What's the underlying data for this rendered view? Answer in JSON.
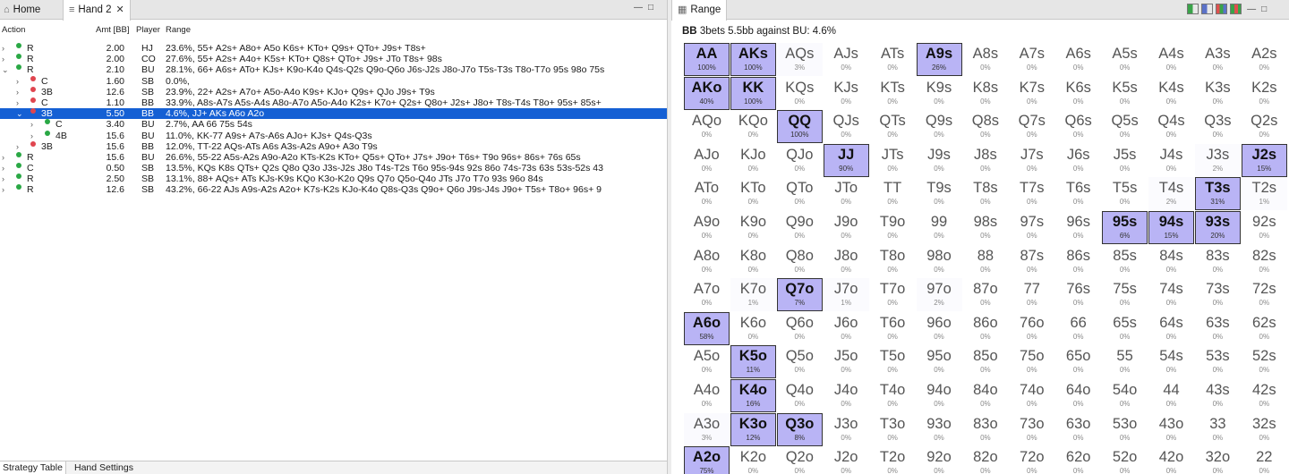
{
  "left_panel": {
    "tabs": [
      {
        "label": "Home",
        "icon": "home-icon"
      },
      {
        "label": "Hand 2",
        "icon": "tree-icon"
      }
    ],
    "columns": {
      "action": "Action",
      "amt": "Amt [BB]",
      "player": "Player",
      "range": "Range"
    },
    "rows": [
      {
        "level": 0,
        "expanded": false,
        "dot": "#2aa845",
        "action": "R",
        "amt": "2.00",
        "player": "HJ",
        "range": "23.6%, 55+ A2s+ A8o+ A5o K6s+ KTo+ Q9s+ QTo+ J9s+ T8s+",
        "selected": false
      },
      {
        "level": 0,
        "expanded": false,
        "dot": "#2aa845",
        "action": "R",
        "amt": "2.00",
        "player": "CO",
        "range": "27.6%, 55+ A2s+ A4o+ K5s+ KTo+ Q8s+ QTo+ J9s+ JTo T8s+ 98s",
        "selected": false
      },
      {
        "level": 0,
        "expanded": true,
        "dot": "#2aa845",
        "action": "R",
        "amt": "2.10",
        "player": "BU",
        "range": "28.1%, 66+ A6s+ ATo+ KJs+ K9o-K4o Q4s-Q2s Q9o-Q6o J6s-J2s J8o-J7o T5s-T3s T8o-T7o 95s 98o 75s",
        "selected": false
      },
      {
        "level": 1,
        "expanded": false,
        "dot": "#e0454f",
        "action": "C",
        "amt": "1.60",
        "player": "SB",
        "range": "0.0%,",
        "selected": false
      },
      {
        "level": 1,
        "expanded": false,
        "dot": "#e0454f",
        "action": "3B",
        "amt": "12.6",
        "player": "SB",
        "range": "23.9%, 22+ A2s+ A7o+ A5o-A4o K9s+ KJo+ Q9s+ QJo J9s+ T9s",
        "selected": false
      },
      {
        "level": 1,
        "expanded": false,
        "dot": "#e0454f",
        "action": "C",
        "amt": "1.10",
        "player": "BB",
        "range": "33.9%, A8s-A7s A5s-A4s A8o-A7o A5o-A4o K2s+ K7o+ Q2s+ Q8o+ J2s+ J8o+ T8s-T4s T8o+ 95s+ 85s+",
        "selected": false
      },
      {
        "level": 1,
        "expanded": true,
        "dot": "#e0454f",
        "action": "3B",
        "amt": "5.50",
        "player": "BB",
        "range": "4.6%, JJ+ AKs A6o A2o",
        "selected": true
      },
      {
        "level": 2,
        "expanded": false,
        "dot": "#2aa845",
        "action": "C",
        "amt": "3.40",
        "player": "BU",
        "range": "2.7%, AA 66 75s 54s",
        "selected": false
      },
      {
        "level": 2,
        "expanded": false,
        "dot": "#2aa845",
        "action": "4B",
        "amt": "15.6",
        "player": "BU",
        "range": "11.0%, KK-77 A9s+ A7s-A6s AJo+ KJs+ Q4s-Q3s",
        "selected": false
      },
      {
        "level": 1,
        "expanded": false,
        "dot": "#e0454f",
        "action": "3B",
        "amt": "15.6",
        "player": "BB",
        "range": "12.0%, TT-22 AQs-ATs A6s A3s-A2s A9o+ A3o T9s",
        "selected": false
      },
      {
        "level": 0,
        "expanded": false,
        "dot": "#2aa845",
        "action": "R",
        "amt": "15.6",
        "player": "BU",
        "range": "26.6%, 55-22 A5s-A2s A9o-A2o KTs-K2s KTo+ Q5s+ QTo+ J7s+ J9o+ T6s+ T9o 96s+ 86s+ 76s 65s",
        "selected": false
      },
      {
        "level": 0,
        "expanded": false,
        "dot": "#2aa845",
        "action": "C",
        "amt": "0.50",
        "player": "SB",
        "range": "13.5%, KQs K8s QTs+ Q2s Q8o Q3o J3s-J2s J8o T4s-T2s T6o 95s-94s 92s 86o 74s-73s 63s 53s-52s 43",
        "selected": false
      },
      {
        "level": 0,
        "expanded": false,
        "dot": "#2aa845",
        "action": "R",
        "amt": "2.50",
        "player": "SB",
        "range": "13.1%, 88+ AQs+ ATs KJs-K9s KQo K3o-K2o Q9s Q7o Q5o-Q4o JTs J7o T7o 93s 96o 84s",
        "selected": false
      },
      {
        "level": 0,
        "expanded": false,
        "dot": "#2aa845",
        "action": "R",
        "amt": "12.6",
        "player": "SB",
        "range": "43.2%, 66-22 AJs A9s-A2s A2o+ K7s-K2s KJo-K4o Q8s-Q3s Q9o+ Q6o J9s-J4s J9o+ T5s+ T8o+ 96s+ 9",
        "selected": false
      }
    ],
    "bottom_tabs": [
      "Strategy Table",
      "Hand Settings"
    ]
  },
  "right_panel": {
    "tab": {
      "label": "Range",
      "icon": "range-icon"
    },
    "title_player": "BB",
    "title_text": "3bets 5.5bb against BU: 4.6%",
    "highlight_color": "#b9b4f5",
    "grid": [
      [
        [
          "AA",
          "100%"
        ],
        [
          "AKs",
          "100%"
        ],
        [
          "AQs",
          "3%"
        ],
        [
          "AJs",
          "0%"
        ],
        [
          "ATs",
          "0%"
        ],
        [
          "A9s",
          "26%"
        ],
        [
          "A8s",
          "0%"
        ],
        [
          "A7s",
          "0%"
        ],
        [
          "A6s",
          "0%"
        ],
        [
          "A5s",
          "0%"
        ],
        [
          "A4s",
          "0%"
        ],
        [
          "A3s",
          "0%"
        ],
        [
          "A2s",
          "0%"
        ]
      ],
      [
        [
          "AKo",
          "40%"
        ],
        [
          "KK",
          "100%"
        ],
        [
          "KQs",
          "0%"
        ],
        [
          "KJs",
          "0%"
        ],
        [
          "KTs",
          "0%"
        ],
        [
          "K9s",
          "0%"
        ],
        [
          "K8s",
          "0%"
        ],
        [
          "K7s",
          "0%"
        ],
        [
          "K6s",
          "0%"
        ],
        [
          "K5s",
          "0%"
        ],
        [
          "K4s",
          "0%"
        ],
        [
          "K3s",
          "0%"
        ],
        [
          "K2s",
          "0%"
        ]
      ],
      [
        [
          "AQo",
          "0%"
        ],
        [
          "KQo",
          "0%"
        ],
        [
          "QQ",
          "100%"
        ],
        [
          "QJs",
          "0%"
        ],
        [
          "QTs",
          "0%"
        ],
        [
          "Q9s",
          "0%"
        ],
        [
          "Q8s",
          "0%"
        ],
        [
          "Q7s",
          "0%"
        ],
        [
          "Q6s",
          "0%"
        ],
        [
          "Q5s",
          "0%"
        ],
        [
          "Q4s",
          "0%"
        ],
        [
          "Q3s",
          "0%"
        ],
        [
          "Q2s",
          "0%"
        ]
      ],
      [
        [
          "AJo",
          "0%"
        ],
        [
          "KJo",
          "0%"
        ],
        [
          "QJo",
          "0%"
        ],
        [
          "JJ",
          "90%"
        ],
        [
          "JTs",
          "0%"
        ],
        [
          "J9s",
          "0%"
        ],
        [
          "J8s",
          "0%"
        ],
        [
          "J7s",
          "0%"
        ],
        [
          "J6s",
          "0%"
        ],
        [
          "J5s",
          "0%"
        ],
        [
          "J4s",
          "0%"
        ],
        [
          "J3s",
          "2%"
        ],
        [
          "J2s",
          "15%"
        ]
      ],
      [
        [
          "ATo",
          "0%"
        ],
        [
          "KTo",
          "0%"
        ],
        [
          "QTo",
          "0%"
        ],
        [
          "JTo",
          "0%"
        ],
        [
          "TT",
          "0%"
        ],
        [
          "T9s",
          "0%"
        ],
        [
          "T8s",
          "0%"
        ],
        [
          "T7s",
          "0%"
        ],
        [
          "T6s",
          "0%"
        ],
        [
          "T5s",
          "0%"
        ],
        [
          "T4s",
          "2%"
        ],
        [
          "T3s",
          "31%"
        ],
        [
          "T2s",
          "1%"
        ]
      ],
      [
        [
          "A9o",
          "0%"
        ],
        [
          "K9o",
          "0%"
        ],
        [
          "Q9o",
          "0%"
        ],
        [
          "J9o",
          "0%"
        ],
        [
          "T9o",
          "0%"
        ],
        [
          "99",
          "0%"
        ],
        [
          "98s",
          "0%"
        ],
        [
          "97s",
          "0%"
        ],
        [
          "96s",
          "0%"
        ],
        [
          "95s",
          "6%"
        ],
        [
          "94s",
          "15%"
        ],
        [
          "93s",
          "20%"
        ],
        [
          "92s",
          "0%"
        ]
      ],
      [
        [
          "A8o",
          "0%"
        ],
        [
          "K8o",
          "0%"
        ],
        [
          "Q8o",
          "0%"
        ],
        [
          "J8o",
          "0%"
        ],
        [
          "T8o",
          "0%"
        ],
        [
          "98o",
          "0%"
        ],
        [
          "88",
          "0%"
        ],
        [
          "87s",
          "0%"
        ],
        [
          "86s",
          "0%"
        ],
        [
          "85s",
          "0%"
        ],
        [
          "84s",
          "0%"
        ],
        [
          "83s",
          "0%"
        ],
        [
          "82s",
          "0%"
        ]
      ],
      [
        [
          "A7o",
          "0%"
        ],
        [
          "K7o",
          "1%"
        ],
        [
          "Q7o",
          "7%"
        ],
        [
          "J7o",
          "1%"
        ],
        [
          "T7o",
          "0%"
        ],
        [
          "97o",
          "2%"
        ],
        [
          "87o",
          "0%"
        ],
        [
          "77",
          "0%"
        ],
        [
          "76s",
          "0%"
        ],
        [
          "75s",
          "0%"
        ],
        [
          "74s",
          "0%"
        ],
        [
          "73s",
          "0%"
        ],
        [
          "72s",
          "0%"
        ]
      ],
      [
        [
          "A6o",
          "58%"
        ],
        [
          "K6o",
          "0%"
        ],
        [
          "Q6o",
          "0%"
        ],
        [
          "J6o",
          "0%"
        ],
        [
          "T6o",
          "0%"
        ],
        [
          "96o",
          "0%"
        ],
        [
          "86o",
          "0%"
        ],
        [
          "76o",
          "0%"
        ],
        [
          "66",
          "0%"
        ],
        [
          "65s",
          "0%"
        ],
        [
          "64s",
          "0%"
        ],
        [
          "63s",
          "0%"
        ],
        [
          "62s",
          "0%"
        ]
      ],
      [
        [
          "A5o",
          "0%"
        ],
        [
          "K5o",
          "11%"
        ],
        [
          "Q5o",
          "0%"
        ],
        [
          "J5o",
          "0%"
        ],
        [
          "T5o",
          "0%"
        ],
        [
          "95o",
          "0%"
        ],
        [
          "85o",
          "0%"
        ],
        [
          "75o",
          "0%"
        ],
        [
          "65o",
          "0%"
        ],
        [
          "55",
          "0%"
        ],
        [
          "54s",
          "0%"
        ],
        [
          "53s",
          "0%"
        ],
        [
          "52s",
          "0%"
        ]
      ],
      [
        [
          "A4o",
          "0%"
        ],
        [
          "K4o",
          "16%"
        ],
        [
          "Q4o",
          "0%"
        ],
        [
          "J4o",
          "0%"
        ],
        [
          "T4o",
          "0%"
        ],
        [
          "94o",
          "0%"
        ],
        [
          "84o",
          "0%"
        ],
        [
          "74o",
          "0%"
        ],
        [
          "64o",
          "0%"
        ],
        [
          "54o",
          "0%"
        ],
        [
          "44",
          "0%"
        ],
        [
          "43s",
          "0%"
        ],
        [
          "42s",
          "0%"
        ]
      ],
      [
        [
          "A3o",
          "3%"
        ],
        [
          "K3o",
          "12%"
        ],
        [
          "Q3o",
          "8%"
        ],
        [
          "J3o",
          "0%"
        ],
        [
          "T3o",
          "0%"
        ],
        [
          "93o",
          "0%"
        ],
        [
          "83o",
          "0%"
        ],
        [
          "73o",
          "0%"
        ],
        [
          "63o",
          "0%"
        ],
        [
          "53o",
          "0%"
        ],
        [
          "43o",
          "0%"
        ],
        [
          "33",
          "0%"
        ],
        [
          "32s",
          "0%"
        ]
      ],
      [
        [
          "A2o",
          "75%"
        ],
        [
          "K2o",
          "0%"
        ],
        [
          "Q2o",
          "0%"
        ],
        [
          "J2o",
          "0%"
        ],
        [
          "T2o",
          "0%"
        ],
        [
          "92o",
          "0%"
        ],
        [
          "82o",
          "0%"
        ],
        [
          "72o",
          "0%"
        ],
        [
          "62o",
          "0%"
        ],
        [
          "52o",
          "0%"
        ],
        [
          "42o",
          "0%"
        ],
        [
          "32o",
          "0%"
        ],
        [
          "22",
          "0%"
        ]
      ]
    ]
  }
}
